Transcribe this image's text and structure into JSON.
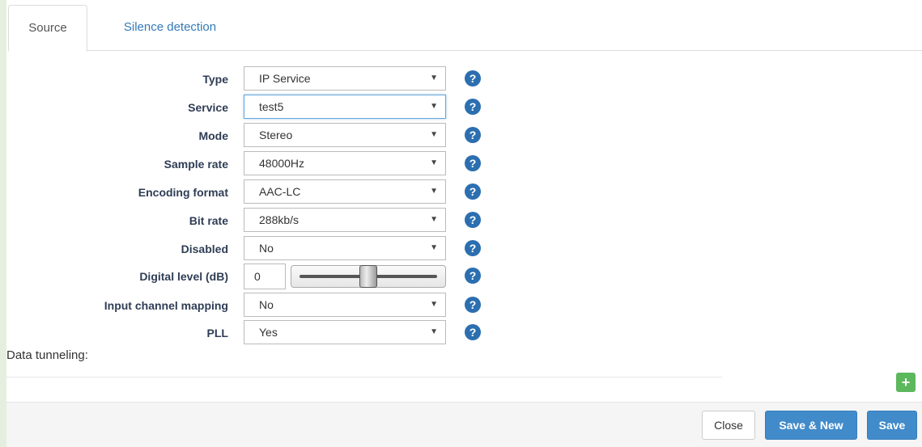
{
  "tabs": [
    {
      "label": "Source",
      "active": true
    },
    {
      "label": "Silence detection",
      "active": false
    }
  ],
  "form": {
    "type": {
      "label": "Type",
      "value": "IP Service"
    },
    "service": {
      "label": "Service",
      "value": "test5"
    },
    "mode": {
      "label": "Mode",
      "value": "Stereo"
    },
    "sample_rate": {
      "label": "Sample rate",
      "value": "48000Hz"
    },
    "encoding_format": {
      "label": "Encoding format",
      "value": "AAC-LC"
    },
    "bit_rate": {
      "label": "Bit rate",
      "value": "288kb/s"
    },
    "disabled": {
      "label": "Disabled",
      "value": "No"
    },
    "digital_level": {
      "label": "Digital level (dB)",
      "value": "0",
      "slider_fraction": 0.5
    },
    "input_channel_mapping": {
      "label": "Input channel mapping",
      "value": "No"
    },
    "pll": {
      "label": "PLL",
      "value": "Yes"
    }
  },
  "help_glyph": "?",
  "data_tunneling": {
    "label": "Data tunneling:",
    "add_icon": "plus-icon",
    "add_glyph": "+"
  },
  "footer": {
    "close_label": "Close",
    "save_new_label": "Save & New",
    "save_label": "Save"
  },
  "colors": {
    "primary": "#428bca",
    "help": "#2c6fb0",
    "add": "#5cb85c",
    "link": "#337ab7"
  }
}
